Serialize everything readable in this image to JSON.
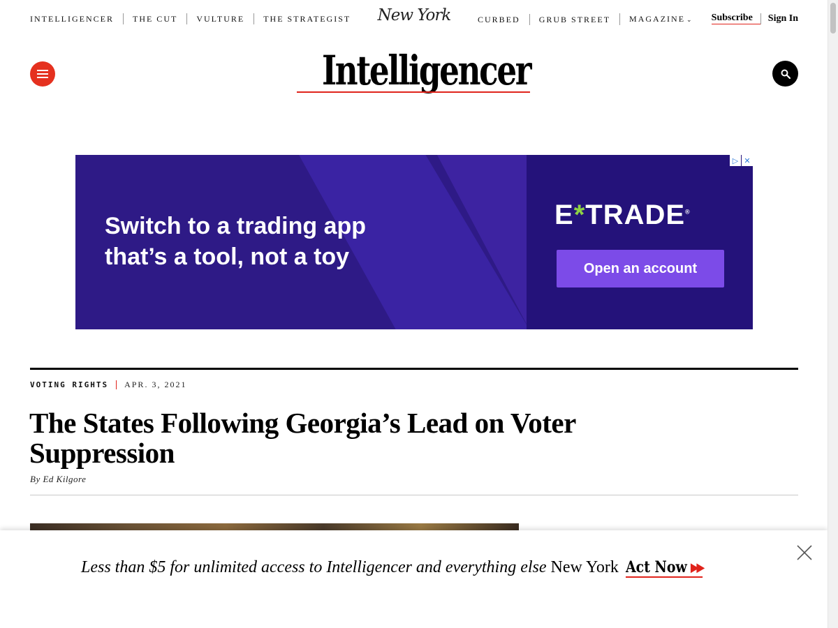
{
  "nav": {
    "left": [
      "INTELLIGENCER",
      "THE CUT",
      "VULTURE",
      "THE STRATEGIST"
    ],
    "logo": "New York",
    "right": [
      "CURBED",
      "GRUB STREET",
      "MAGAZINE"
    ],
    "subscribe": "Subscribe",
    "signin": "Sign In"
  },
  "brand": {
    "masthead": "Intelligencer"
  },
  "ad": {
    "headline": "Switch to a trading app\nthat’s a tool, not a toy",
    "logo_left": "E",
    "logo_x": "*",
    "logo_right": "TRADE",
    "registered": "®",
    "cta": "Open an account",
    "badge_play": "▷",
    "badge_close": "✕"
  },
  "article": {
    "rubric": "VOTING RIGHTS",
    "date": "APR. 3, 2021",
    "headline": "The States Following Georgia’s Lead on Voter Suppression",
    "byline": "By Ed Kilgore"
  },
  "banner": {
    "promo": "Less than $5 for unlimited access to Intelligencer and everything else",
    "brand": "New York",
    "cta": "Act Now"
  },
  "colors": {
    "accent": "#e0231b",
    "ad_bg": "#2e1a86",
    "ad_cta": "#7c4be8",
    "etrade_green": "#8ed144"
  }
}
